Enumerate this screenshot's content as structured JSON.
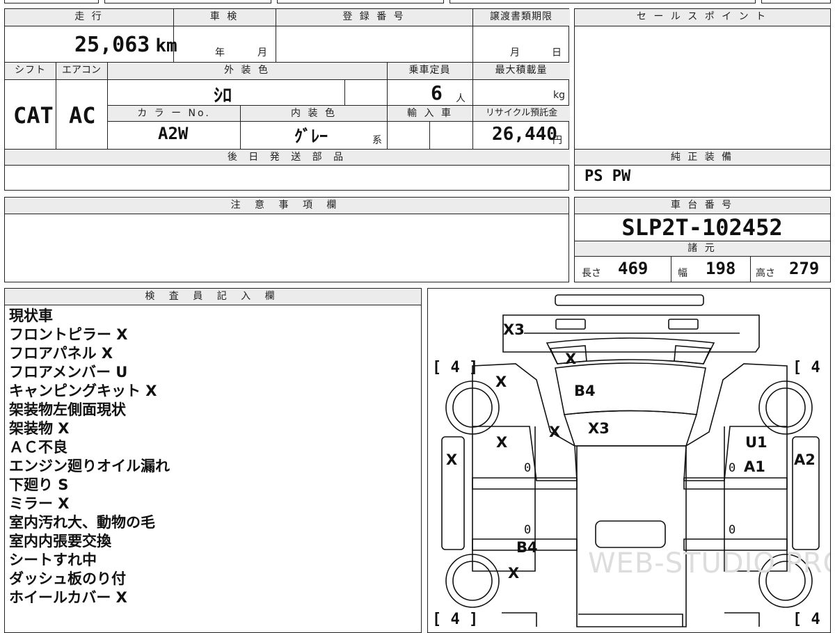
{
  "header": {
    "mileage_label": "走 行",
    "inspection_label": "車 検",
    "registration_label": "登 録 番 号",
    "transfer_deadline_label": "譲渡書類期限",
    "sales_point_label": "セ ー ル ス ポ イ ン ト"
  },
  "vehicle": {
    "mileage": "25,063",
    "mileage_unit": "km",
    "inspection_year_unit": "年",
    "inspection_month_unit": "月",
    "deadline_month_unit": "月",
    "deadline_day_unit": "日",
    "shift_label": "シフト",
    "shift": "CAT",
    "aircon_label": "エアコン",
    "aircon": "AC",
    "exterior_color_label": "外 装 色",
    "exterior_color": "ｼﾛ",
    "capacity_label": "乗車定員",
    "capacity": "6",
    "capacity_unit": "人",
    "max_load_label": "最大積載量",
    "max_load_unit": "kg",
    "color_no_label": "カ ラ ー No.",
    "color_no": "A2W",
    "interior_color_label": "内 装 色",
    "interior_color": "ｸﾞﾚｰ",
    "interior_color_suffix": "系",
    "import_label": "輸 入 車",
    "recycle_label": "リサイクル預託金",
    "recycle_fee": "26,440",
    "recycle_unit": "円"
  },
  "later_parts": {
    "label": "後 日 発 送 部 品"
  },
  "genuine_equipment": {
    "label": "純 正 装 備",
    "value": "PS PW"
  },
  "notes": {
    "label": "注 意 事 項 欄"
  },
  "chassis": {
    "label": "車 台 番 号",
    "number": "SLP2T-102452",
    "specs_label": "諸 元",
    "length_label": "長さ",
    "length": "469",
    "width_label": "幅",
    "width": "198",
    "height_label": "高さ",
    "height": "279"
  },
  "inspector": {
    "label": "検 査 員 記 入 欄",
    "lines": [
      "現状車",
      "フロントピラー X",
      "フロアパネル X",
      "フロアメンバー U",
      "キャンピングキット X",
      "架装物左側面現状",
      "架装物 X",
      "ＡＣ不良",
      "エンジン廻りオイル漏れ",
      "下廻り S",
      "ミラー X",
      "室内汚れ大、動物の毛",
      "室内内張要交換",
      "シートすれ中",
      "ダッシュ板のり付",
      "ホイールカバー X"
    ]
  },
  "diagram": {
    "marks": {
      "roof_front": "X3",
      "windshield": "X",
      "hood_left": "X",
      "hood": "B4",
      "pillar_left": "X",
      "cowl": "X3",
      "fender_left": "X",
      "door_left": "X",
      "fender_right": "U1",
      "front_right": "A1",
      "door_right": "A2",
      "rocker_left": "B4",
      "wheel_rear_left": "X"
    },
    "tire_tl": "[ 4 ]",
    "tire_tr": "[ 4 ]",
    "tire_bl": "[ 4 ]",
    "tire_br": "[ 4 ]",
    "zero_1": "0",
    "zero_2": "0",
    "zero_3": "0",
    "zero_4": "0",
    "watermark": "WEB-STUDIO PRO"
  }
}
